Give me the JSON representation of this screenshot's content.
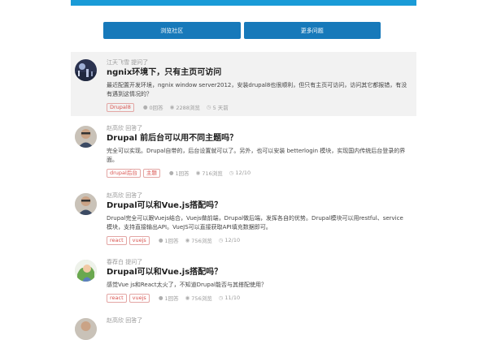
{
  "nav": {
    "browse_label": "浏览社区",
    "more_label": "更多问题"
  },
  "questions": [
    {
      "author_line": "江天飞雪 提问了",
      "title": "ngnix环境下，只有主页可访问",
      "excerpt": "最近配置开发环境，ngnix window server2012，安装drupal8也很顺利，但只有主页可访问，访问其它都报错，有没有遇到这情况的？",
      "tags": [
        "Drupal8"
      ],
      "answers": "0回答",
      "views": "2288浏览",
      "date": "5 天前"
    },
    {
      "author_line": "赵高欣 回答了",
      "title": "Drupal 前后台可以用不同主题吗？",
      "excerpt": "完全可以实现。Drupal自带的，后台设置就可以了。另外，也可以安装 betterlogin 模块，实现国内传统后台登录的界面。",
      "tags": [
        "drupal后台",
        "主题"
      ],
      "answers": "1回答",
      "views": "716浏览",
      "date": "12/10"
    },
    {
      "author_line": "赵高欣 回答了",
      "title": "Drupal可以和Vue.js搭配吗？",
      "excerpt": "Drupal完全可以跟Vuejs结合，Vuejs做前端，Drupal做后端，发挥各自的优势。Drupal模块可以用restful、service模块，支持直接输出API。VueJS可以直接获取API填充数据即可。",
      "tags": [
        "react",
        "vuejs"
      ],
      "answers": "1回答",
      "views": "756浏览",
      "date": "12/10"
    },
    {
      "author_line": "春荐白 提问了",
      "title": "Drupal可以和Vue.js搭配吗？",
      "excerpt": "感觉Vue js和React太火了，不知道Drupal能否与其搭配使用？",
      "tags": [
        "react",
        "vuejs"
      ],
      "answers": "1回答",
      "views": "756浏览",
      "date": "11/10"
    },
    {
      "author_line": "赵高欣 回答了"
    }
  ]
}
